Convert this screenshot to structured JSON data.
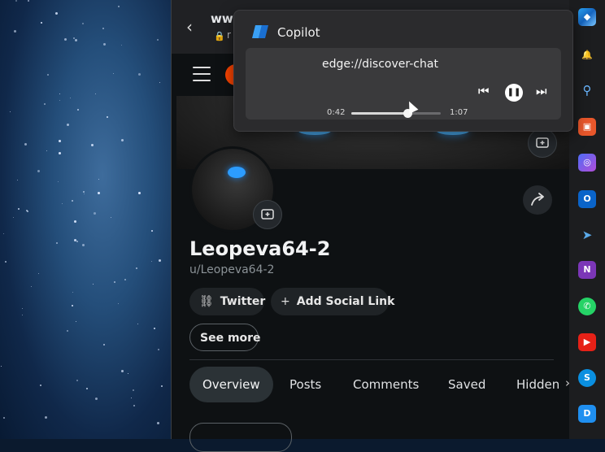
{
  "browser": {
    "url_main": "www",
    "url_sub": "r",
    "back_glyph": "‹",
    "lock_glyph": "🔒"
  },
  "profile": {
    "username": "Leopeva64-2",
    "handle": "u/Leopeva64-2",
    "social_links": [
      {
        "label": "Twitter",
        "icon": "link-icon"
      },
      {
        "label": "Add Social Link",
        "icon": "plus-icon"
      }
    ],
    "see_more_label": "See more"
  },
  "tabs": [
    {
      "label": "Overview",
      "active": true
    },
    {
      "label": "Posts",
      "active": false
    },
    {
      "label": "Comments",
      "active": false
    },
    {
      "label": "Saved",
      "active": false
    },
    {
      "label": "Hidden",
      "active": false
    }
  ],
  "copilot": {
    "title": "Copilot",
    "media_title": "edge://discover-chat",
    "time_elapsed": "0:42",
    "time_total": "1:07",
    "progress_fraction": 0.63
  },
  "sidebar": {
    "icons": [
      "copilot-icon",
      "bell-icon",
      "search-icon",
      "toolbox-icon",
      "copilot-m365-icon",
      "outlook-icon",
      "telegram-icon",
      "onenote-icon",
      "whatsapp-icon",
      "youtube-icon",
      "skype-icon",
      "discord-icon"
    ]
  },
  "colors": {
    "accent_orange": "#ff4500",
    "page_bg": "#0e1113",
    "popup_bg": "#2b2b2d"
  }
}
